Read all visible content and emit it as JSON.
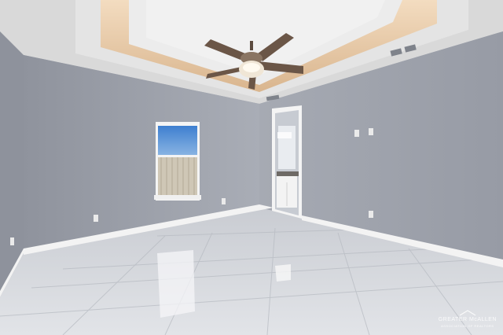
{
  "scene": {
    "description_label": "Empty room with tray ceiling, ceiling fan, window and tiled floor",
    "colors": {
      "wall": "#9ea3ad",
      "wall_light": "#b3b7c0",
      "ceiling": "#e6e6e6",
      "tray_glow": "#e8c9a6",
      "floor": "#d8dbe0",
      "baseboard": "#f4f4f4",
      "fan_blade": "#6b5647"
    },
    "icons": [
      "ceiling-fan-icon",
      "window-icon",
      "doorway-icon",
      "vent-icon",
      "outlet-icon"
    ]
  },
  "watermark": {
    "text": "GREATER McALLEN",
    "sub": "ASSOCIATION OF REALTORS"
  }
}
